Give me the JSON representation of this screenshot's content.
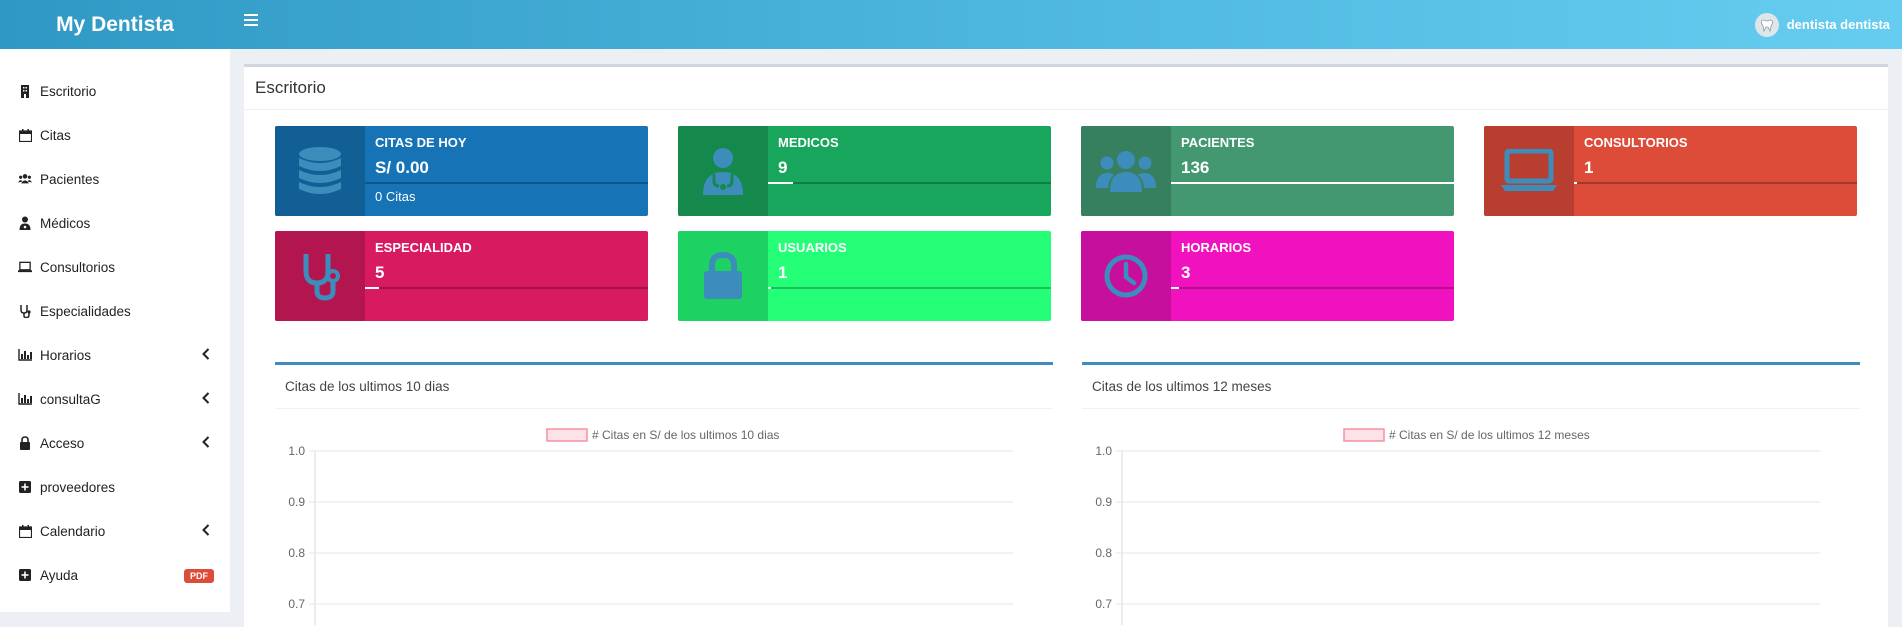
{
  "app": {
    "title": "My Dentista"
  },
  "user": {
    "name": "dentista dentista"
  },
  "page": {
    "title": "Escritorio"
  },
  "sidebar": {
    "items": [
      {
        "label": "Escritorio",
        "icon": "building-icon"
      },
      {
        "label": "Citas",
        "icon": "calendar-icon"
      },
      {
        "label": "Pacientes",
        "icon": "users-icon"
      },
      {
        "label": "Médicos",
        "icon": "doctor-icon"
      },
      {
        "label": "Consultorios",
        "icon": "laptop-icon"
      },
      {
        "label": "Especialidades",
        "icon": "stethoscope-icon"
      },
      {
        "label": "Horarios",
        "icon": "chart-icon",
        "expandable": true
      },
      {
        "label": "consultaG",
        "icon": "chart-icon",
        "expandable": true
      },
      {
        "label": "Acceso",
        "icon": "lock-icon",
        "expandable": true
      },
      {
        "label": "proveedores",
        "icon": "plus-square-icon"
      },
      {
        "label": "Calendario",
        "icon": "calendar-icon",
        "expandable": true
      },
      {
        "label": "Ayuda",
        "icon": "plus-square-icon",
        "badge": "PDF"
      }
    ]
  },
  "cards": [
    {
      "label": "CITAS DE HOY",
      "value": "S/ 0.00",
      "sub": "0 Citas",
      "icon": "database-icon",
      "color": "#1673b5",
      "icon_bg": "#125f95",
      "progress": 0
    },
    {
      "label": "MEDICOS",
      "value": "9",
      "sub": "",
      "icon": "doctor-icon",
      "color": "#18a65c",
      "icon_bg": "#14894b",
      "progress": 0.09
    },
    {
      "label": "PACIENTES",
      "value": "136",
      "sub": "",
      "icon": "users-icon",
      "color": "#439872",
      "icon_bg": "#37805f",
      "progress": 1
    },
    {
      "label": "CONSULTORIOS",
      "value": "1",
      "sub": "",
      "icon": "laptop-icon",
      "color": "#dd4b39",
      "icon_bg": "#b83e2f",
      "progress": 0.01
    },
    {
      "label": "ESPECIALIDAD",
      "value": "5",
      "sub": "",
      "icon": "stethoscope-icon",
      "color": "#d81b60",
      "icon_bg": "#b3164f",
      "progress": 0.05
    },
    {
      "label": "USUARIOS",
      "value": "1",
      "sub": "",
      "icon": "lock-icon",
      "color": "#24ff77",
      "icon_bg": "#1ed163",
      "progress": 0.01
    },
    {
      "label": "HORARIOS",
      "value": "3",
      "sub": "",
      "icon": "clock-icon",
      "color": "#f012be",
      "icon_bg": "#c70f9e",
      "progress": 0.03
    }
  ],
  "panels": [
    {
      "title": "Citas de los ultimos 10 dias"
    },
    {
      "title": "Citas de los ultimos 12 meses"
    }
  ],
  "chart_data": [
    {
      "type": "bar",
      "title": "",
      "series": [
        {
          "name": "# Citas en S/ de los ultimos 10 dias",
          "values": []
        }
      ],
      "yticks": [
        "1.0",
        "0.9",
        "0.8",
        "0.7"
      ],
      "ylim": [
        0,
        1.0
      ],
      "legend": "top"
    },
    {
      "type": "bar",
      "title": "",
      "series": [
        {
          "name": "# Citas en S/ de los ultimos 12 meses",
          "values": []
        }
      ],
      "yticks": [
        "1.0",
        "0.9",
        "0.8",
        "0.7"
      ],
      "ylim": [
        0,
        1.0
      ],
      "legend": "top"
    }
  ]
}
